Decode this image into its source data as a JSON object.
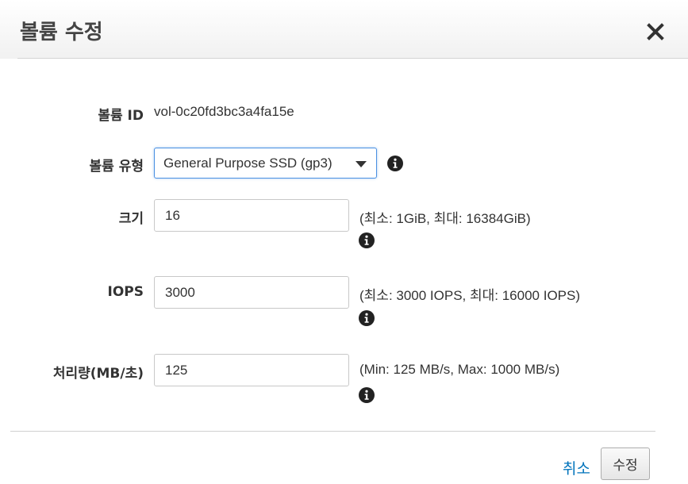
{
  "dialog": {
    "title": "볼륨 수정",
    "close_icon": "close-icon"
  },
  "form": {
    "volume_id": {
      "label": "볼륨 ID",
      "value": "vol-0c20fd3bc3a4fa15e"
    },
    "volume_type": {
      "label": "볼륨 유형",
      "selected": "General Purpose SSD (gp3)",
      "info_icon": "info-icon"
    },
    "size": {
      "label": "크기",
      "value": "16",
      "hint": "(최소: 1GiB, 최대: 16384GiB)",
      "info_icon": "info-icon"
    },
    "iops": {
      "label": "IOPS",
      "value": "3000",
      "hint": "(최소: 3000 IOPS, 최대: 16000 IOPS)",
      "info_icon": "info-icon"
    },
    "throughput": {
      "label": "처리량(MB/초)",
      "value": "125",
      "hint": "(Min: 125 MB/s, Max: 1000 MB/s)",
      "info_icon": "info-icon"
    }
  },
  "footer": {
    "cancel_label": "취소",
    "submit_label": "수정"
  },
  "colors": {
    "link": "#0073bb",
    "focus_border": "#4a90e2",
    "text": "#333333"
  }
}
